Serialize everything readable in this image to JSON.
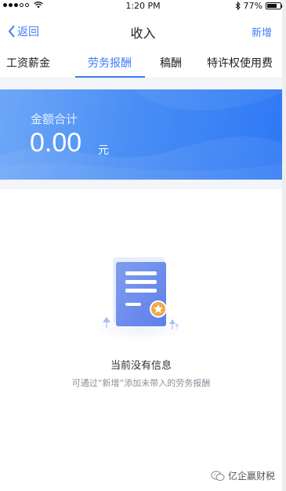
{
  "status_bar": {
    "time": "1:20 PM",
    "battery_text": "77%",
    "battery_level": 0.77,
    "bluetooth_icon": "bluetooth-icon",
    "wifi_icon": "wifi-icon"
  },
  "nav": {
    "back_label": "返回",
    "title": "收入",
    "add_label": "新增"
  },
  "tabs": [
    {
      "label": "工资薪金",
      "active": false
    },
    {
      "label": "劳务报酬",
      "active": true
    },
    {
      "label": "稿酬",
      "active": false
    },
    {
      "label": "特许权使用费",
      "active": false
    }
  ],
  "summary": {
    "label": "金额合计",
    "amount": "0.00",
    "unit": "元"
  },
  "empty_state": {
    "title": "当前没有信息",
    "hint": "可通过“新增”添加未带入的劳务报酬"
  },
  "watermark": {
    "text": "亿企赢财税"
  },
  "colors": {
    "accent": "#3f7cf6",
    "card_gradient_start": "#6ea7f7",
    "card_gradient_end": "#2d78f5",
    "page_bg_strip": "#f4f5f8"
  }
}
